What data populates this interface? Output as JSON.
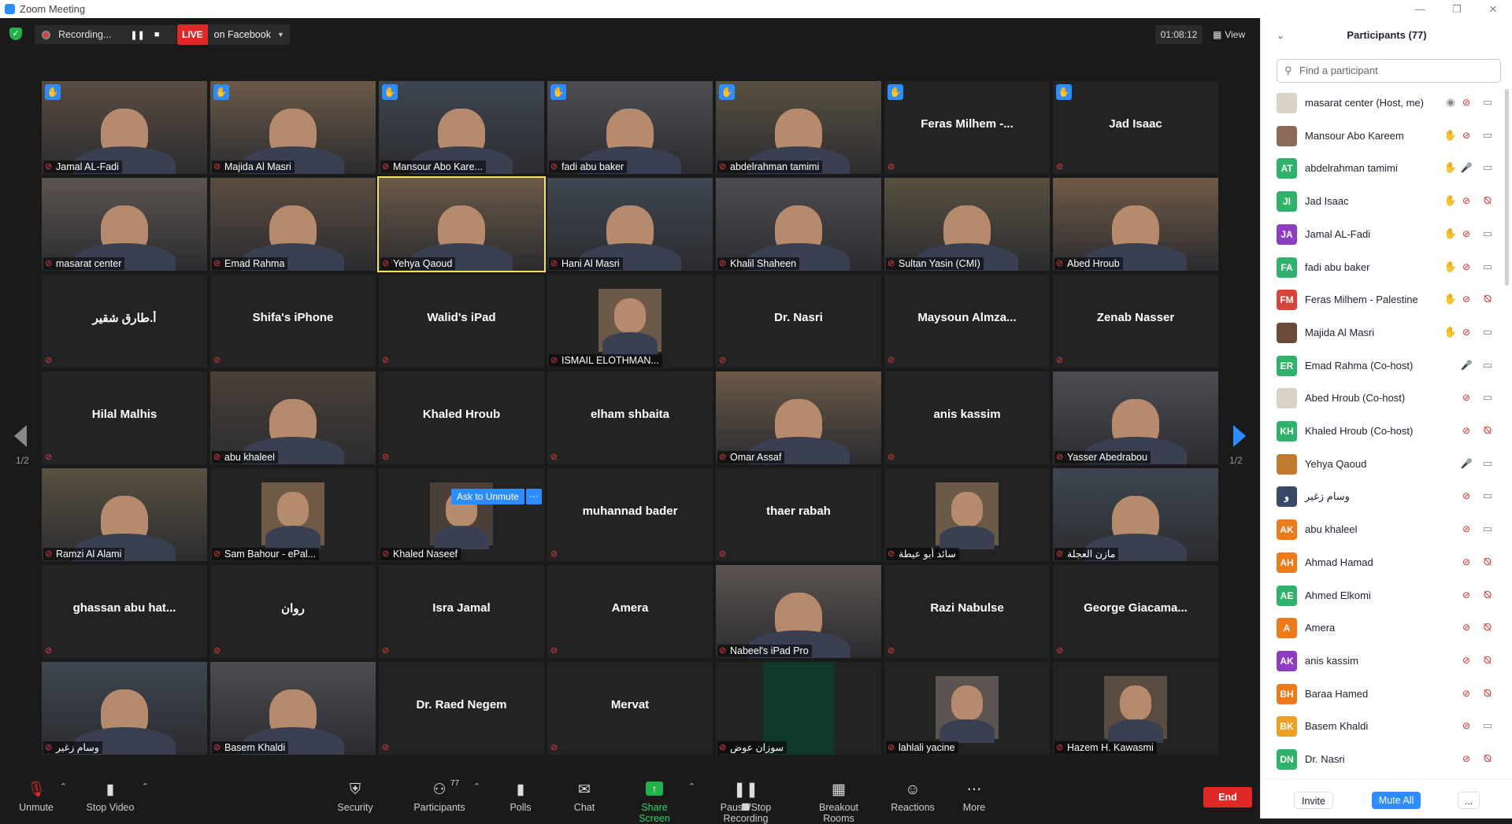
{
  "window": {
    "title": "Zoom Meeting"
  },
  "topbar": {
    "recording_label": "Recording...",
    "live_badge": "LIVE",
    "live_target": "on Facebook",
    "timer": "01:08:12",
    "view_label": "View"
  },
  "tiles": [
    {
      "name": "Jamal AL-Fadi",
      "video": true,
      "hand": true
    },
    {
      "name": "Majida Al Masri",
      "video": true,
      "hand": true
    },
    {
      "name": "Mansour Abo Kare...",
      "video": true,
      "hand": true
    },
    {
      "name": "fadi abu baker",
      "video": true,
      "hand": true
    },
    {
      "name": "abdelrahman tamimi",
      "video": true,
      "hand": true
    },
    {
      "name": "Feras  Milhem -...",
      "video": false,
      "hand": true
    },
    {
      "name": "Jad Isaac",
      "video": false,
      "hand": true
    },
    {
      "name": "masarat center",
      "video": true
    },
    {
      "name": "Emad Rahma",
      "video": true
    },
    {
      "name": "Yehya Qaoud",
      "video": true,
      "active": true
    },
    {
      "name": "Hani Al Masri",
      "video": true
    },
    {
      "name": "Khalil Shaheen",
      "video": true
    },
    {
      "name": "Sultan Yasin (CMI)",
      "video": true
    },
    {
      "name": "Abed Hroub",
      "video": true
    },
    {
      "name": "أ.طارق شقير",
      "video": false
    },
    {
      "name": "Shifa's iPhone",
      "video": false
    },
    {
      "name": "Walid's iPad",
      "video": false
    },
    {
      "name": "ISMAIL ELOTHMAN...",
      "video": true,
      "photo": true
    },
    {
      "name": "Dr. Nasri",
      "video": false
    },
    {
      "name": "Maysoun  Almza...",
      "video": false
    },
    {
      "name": "Zenab Nasser",
      "video": false
    },
    {
      "name": "Hilal Malhis",
      "video": false
    },
    {
      "name": "abu khaleel",
      "video": true
    },
    {
      "name": "Khaled Hroub",
      "video": false
    },
    {
      "name": "elham shbaita",
      "video": false
    },
    {
      "name": "Omar Assaf",
      "video": true
    },
    {
      "name": "anis kassim",
      "video": false
    },
    {
      "name": "Yasser Abedrabou",
      "video": true
    },
    {
      "name": "Ramzi Al Alami",
      "video": true
    },
    {
      "name": "Sam Bahour - ePal...",
      "video": true,
      "photo": true
    },
    {
      "name": "Khaled Naseef",
      "video": true,
      "photo": true
    },
    {
      "name": "muhannad bader",
      "video": false
    },
    {
      "name": "thaer rabah",
      "video": false
    },
    {
      "name": "سائد أبو عيطة",
      "video": true,
      "photo": true
    },
    {
      "name": "مازن العجلة",
      "video": true
    },
    {
      "name": "ghassan abu hat...",
      "video": false
    },
    {
      "name": "روان",
      "video": false
    },
    {
      "name": "Isra Jamal",
      "video": false
    },
    {
      "name": "Amera",
      "video": false
    },
    {
      "name": "Nabeel's iPad Pro",
      "video": true
    },
    {
      "name": "Razi Nabulse",
      "video": false
    },
    {
      "name": "George  Giacama...",
      "video": false
    },
    {
      "name": "وسام زغير",
      "video": true
    },
    {
      "name": "Basem Khaldi",
      "video": true
    },
    {
      "name": "Dr. Raed Negem",
      "video": false
    },
    {
      "name": "Mervat",
      "video": false
    },
    {
      "name": "سوزان عوض",
      "video": true,
      "dark": true
    },
    {
      "name": "lahlali yacine",
      "video": true,
      "photo": true
    },
    {
      "name": "Hazem H. Kawasmi",
      "video": true,
      "photo": true
    }
  ],
  "ask_unmute": {
    "label": "Ask to Unmute",
    "more": "···"
  },
  "pagination": {
    "left": "1/2",
    "right": "1/2"
  },
  "toolbar": {
    "unmute": "Unmute",
    "stop_video": "Stop Video",
    "security": "Security",
    "participants": "Participants",
    "participants_count": "77",
    "polls": "Polls",
    "chat": "Chat",
    "share_screen": "Share Screen",
    "pause_recording": "Pause/Stop Recording",
    "breakout": "Breakout Rooms",
    "reactions": "Reactions",
    "more": "More",
    "end": "End"
  },
  "panel": {
    "title": "Participants (77)",
    "search_placeholder": "Find a participant",
    "invite": "Invite",
    "mute_all": "Mute All",
    "more": "...",
    "participants": [
      {
        "name": "masarat center (Host, me)",
        "initials": "",
        "color": "#d9d2c5",
        "hand": false,
        "rec": true,
        "mic": "off",
        "cam": "on"
      },
      {
        "name": "Mansour Abo Kareem",
        "initials": "",
        "color": "#8a6a58",
        "hand": true,
        "mic": "off",
        "cam": "on"
      },
      {
        "name": "abdelrahman tamimi",
        "initials": "AT",
        "color": "#2fb36b",
        "hand": true,
        "mic": "on",
        "cam": "on"
      },
      {
        "name": "Jad Isaac",
        "initials": "JI",
        "color": "#2fb36b",
        "hand": true,
        "mic": "off",
        "cam": "off"
      },
      {
        "name": "Jamal AL-Fadi",
        "initials": "JA",
        "color": "#8e3cc4",
        "hand": true,
        "mic": "off",
        "cam": "on"
      },
      {
        "name": "fadi abu baker",
        "initials": "FA",
        "color": "#2fb36b",
        "hand": true,
        "mic": "off",
        "cam": "on"
      },
      {
        "name": "Feras Milhem - Palestine",
        "initials": "FM",
        "color": "#d9443a",
        "hand": true,
        "mic": "off",
        "cam": "off"
      },
      {
        "name": "Majida Al Masri",
        "initials": "",
        "color": "#6b4a3a",
        "hand": true,
        "mic": "off",
        "cam": "on"
      },
      {
        "name": "Emad Rahma (Co-host)",
        "initials": "ER",
        "color": "#2fb36b",
        "hand": false,
        "mic": "on",
        "cam": "on"
      },
      {
        "name": "Abed Hroub (Co-host)",
        "initials": "",
        "color": "#d9d2c5",
        "hand": false,
        "mic": "off",
        "cam": "on"
      },
      {
        "name": "Khaled Hroub (Co-host)",
        "initials": "KH",
        "color": "#2fb36b",
        "hand": false,
        "mic": "off",
        "cam": "off"
      },
      {
        "name": "Yehya Qaoud",
        "initials": "",
        "color": "#c47a2e",
        "hand": false,
        "mic": "on",
        "cam": "on"
      },
      {
        "name": "وسام زغير",
        "initials": "و",
        "color": "#3a4a66",
        "hand": false,
        "mic": "off",
        "cam": "on"
      },
      {
        "name": "abu khaleel",
        "initials": "AK",
        "color": "#ef7a1a",
        "hand": false,
        "mic": "off",
        "cam": "on"
      },
      {
        "name": "Ahmad Hamad",
        "initials": "AH",
        "color": "#ef7a1a",
        "hand": false,
        "mic": "off",
        "cam": "off"
      },
      {
        "name": "Ahmed Elkomi",
        "initials": "AE",
        "color": "#2fb36b",
        "hand": false,
        "mic": "off",
        "cam": "off"
      },
      {
        "name": "Amera",
        "initials": "A",
        "color": "#ef7a1a",
        "hand": false,
        "mic": "off",
        "cam": "off"
      },
      {
        "name": "anis kassim",
        "initials": "AK",
        "color": "#8e3cc4",
        "hand": false,
        "mic": "off",
        "cam": "off"
      },
      {
        "name": "Baraa Hamed",
        "initials": "BH",
        "color": "#ef7a1a",
        "hand": false,
        "mic": "off",
        "cam": "off"
      },
      {
        "name": "Basem Khaldi",
        "initials": "BK",
        "color": "#f0a020",
        "hand": false,
        "mic": "off",
        "cam": "on"
      },
      {
        "name": "Dr. Nasri",
        "initials": "DN",
        "color": "#2fb36b",
        "hand": false,
        "mic": "off",
        "cam": "off"
      }
    ]
  }
}
